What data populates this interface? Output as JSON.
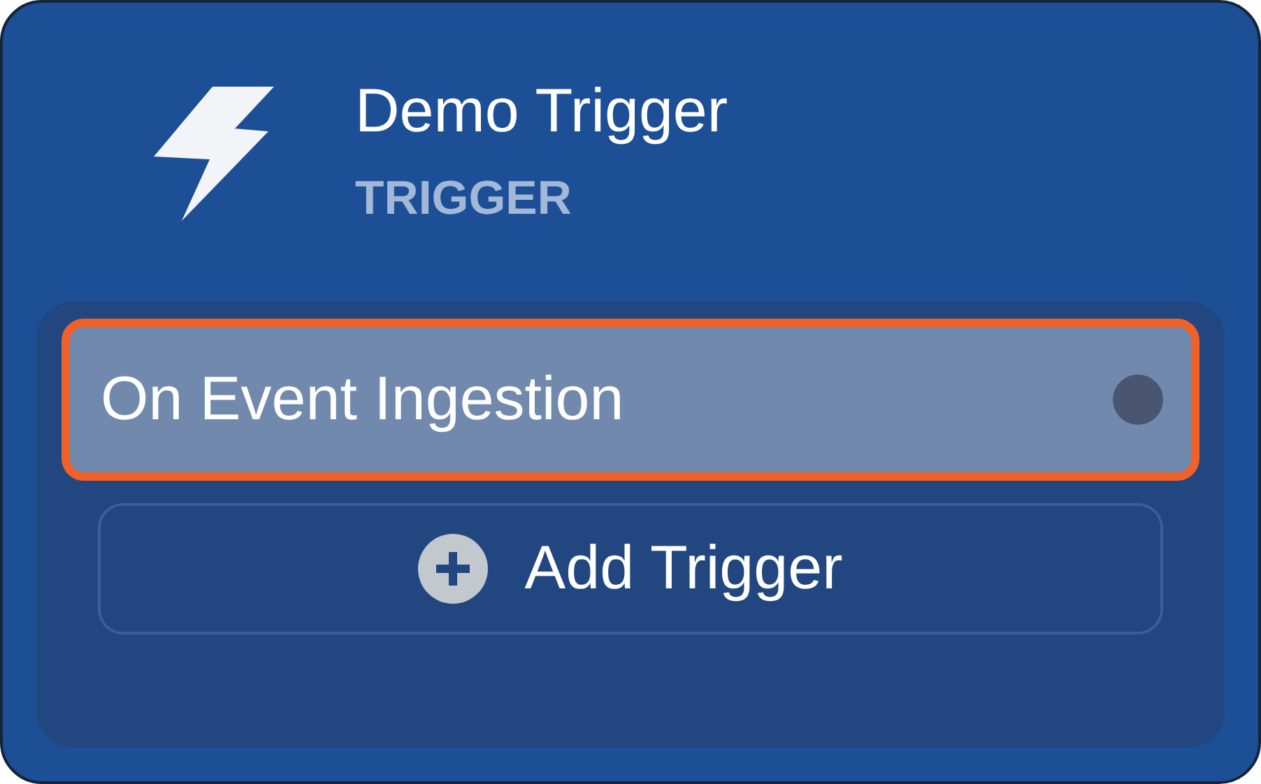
{
  "node": {
    "title": "Demo Trigger",
    "type_label": "TRIGGER"
  },
  "triggers": [
    {
      "label": "On Event Ingestion",
      "selected": true,
      "color": "#4a5570"
    }
  ],
  "add_button": {
    "label": "Add Trigger"
  }
}
